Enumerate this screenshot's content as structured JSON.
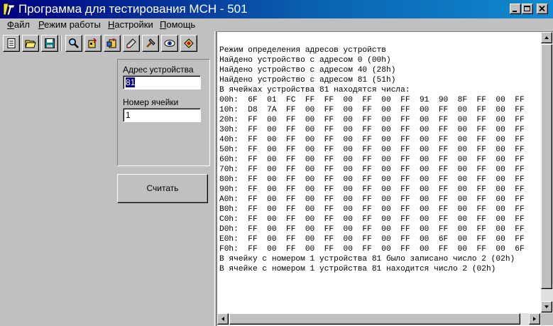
{
  "window": {
    "title": "Программа для тестирования МСН - 501",
    "colors": {
      "titlebar_start": "#000080",
      "titlebar_end": "#108ad0",
      "face": "#c0c0c0"
    }
  },
  "menu": {
    "items": [
      "Файл",
      "Режим работы",
      "Настройки",
      "Помощь"
    ]
  },
  "toolbar": {
    "icons": [
      "new-document-icon",
      "open-folder-icon",
      "save-icon",
      "search-icon",
      "find-devices-icon",
      "read-cell-icon",
      "write-cell-icon",
      "calibrate-icon",
      "view-eye-icon",
      "settings-icon"
    ]
  },
  "form": {
    "address_label": "Адрес устройства",
    "address_value": "81",
    "cell_label": "Номер ячейки",
    "cell_value": "1",
    "read_button": "Считать"
  },
  "log": {
    "lines": [
      "Режим определения адресов устройств",
      "Найдено устройство с адресом 0 (00h)",
      "Найдено устройство с адресом 40 (28h)",
      "Найдено устройство с адресом 81 (51h)",
      "В ячейках устройства 81 находятся числа:",
      "00h:  6F  01  FC  FF  FF  00  FF  00  FF  91  90  8F  FF  00  FF",
      "10h:  D8  7A  FF  00  FF  00  FF  00  FF  00  FF  00  FF  00  FF",
      "20h:  FF  00  FF  00  FF  00  FF  00  FF  00  FF  00  FF  00  FF",
      "30h:  FF  00  FF  00  FF  00  FF  00  FF  00  FF  00  FF  00  FF",
      "40h:  FF  00  FF  00  FF  00  FF  00  FF  00  FF  00  FF  00  FF",
      "50h:  FF  00  FF  00  FF  00  FF  00  FF  00  FF  00  FF  00  FF",
      "60h:  FF  00  FF  00  FF  00  FF  00  FF  00  FF  00  FF  00  FF",
      "70h:  FF  00  FF  00  FF  00  FF  00  FF  00  FF  00  FF  00  FF",
      "80h:  FF  00  FF  00  FF  00  FF  00  FF  00  FF  00  FF  00  FF",
      "90h:  FF  00  FF  00  FF  00  FF  00  FF  00  FF  00  FF  00  FF",
      "A0h:  FF  00  FF  00  FF  00  FF  00  FF  00  FF  00  FF  00  FF",
      "B0h:  FF  00  FF  00  FF  00  FF  00  FF  00  FF  00  FF  00  FF",
      "C0h:  FF  00  FF  00  FF  00  FF  00  FF  00  FF  00  FF  00  FF",
      "D0h:  FF  00  FF  00  FF  00  FF  00  FF  00  FF  00  FF  00  FF",
      "E0h:  FF  00  FF  00  FF  00  FF  00  FF  00  6F  00  FF  00  FF",
      "F0h:  FF  00  FF  00  FF  00  FF  00  FF  00  FF  00  FF  00  6F",
      "В ячейку с номером 1 устройства 81 было записано число 2 (02h)",
      "В ячейке с номером 1 устройства 81 находится число 2 (02h)"
    ]
  }
}
